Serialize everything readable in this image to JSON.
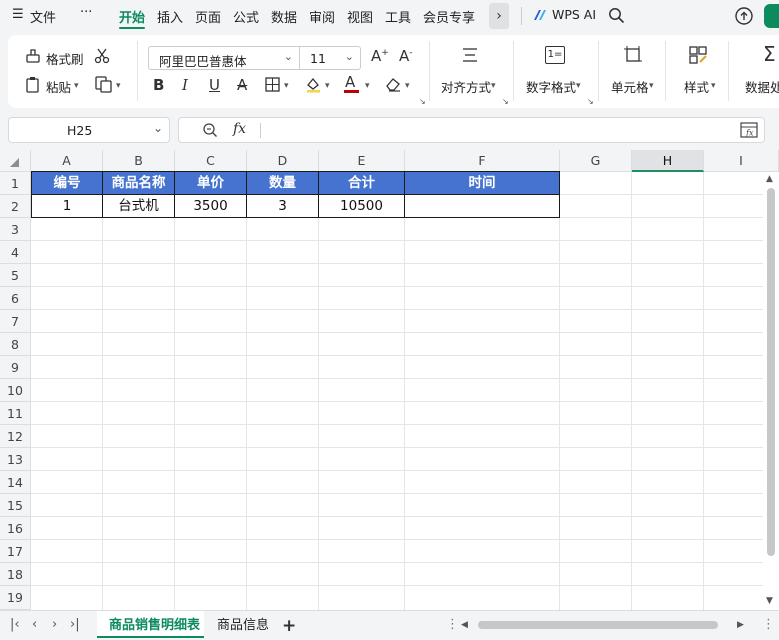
{
  "menubar": {
    "menu_icon": "hamburger-icon",
    "file": "文件",
    "more": "···",
    "tabs": [
      "开始",
      "插入",
      "页面",
      "公式",
      "数据",
      "审阅",
      "视图",
      "工具",
      "会员专享"
    ],
    "active_tab": "开始",
    "wps_ai": "WPS AI"
  },
  "ribbon": {
    "format_painter": "格式刷",
    "paste": "粘贴",
    "font_name": "阿里巴巴普惠体",
    "font_size": "11",
    "bold": "B",
    "italic": "I",
    "underline": "U",
    "strikethrough": "A",
    "font_color_letter": "A",
    "align": "对齐方式",
    "number_format": "数字格式",
    "cell": "单元格",
    "style": "样式",
    "data_processing": "数据处",
    "number_icon_text": "1="
  },
  "formula_bar": {
    "cell_ref": "H25",
    "fx": "fx",
    "formula": ""
  },
  "sheet": {
    "columns": [
      "A",
      "B",
      "C",
      "D",
      "E",
      "F",
      "G",
      "H",
      "I"
    ],
    "selected_column": "H",
    "rows": [
      "1",
      "2",
      "3",
      "4",
      "5",
      "6",
      "7",
      "8",
      "9",
      "10",
      "11",
      "12",
      "13",
      "14",
      "15",
      "16",
      "17",
      "18",
      "19"
    ],
    "header_row": [
      "编号",
      "商品名称",
      "单价",
      "数量",
      "合计",
      "时间"
    ],
    "data_row": [
      "1",
      "台式机",
      "3500",
      "3",
      "10500",
      ""
    ],
    "header_fill": "#4673cf"
  },
  "tabs": {
    "sheets": [
      "商品销售明细表",
      "商品信息"
    ],
    "active": "商品销售明细表",
    "add": "+"
  },
  "colors": {
    "accent": "#0e8a5f"
  }
}
